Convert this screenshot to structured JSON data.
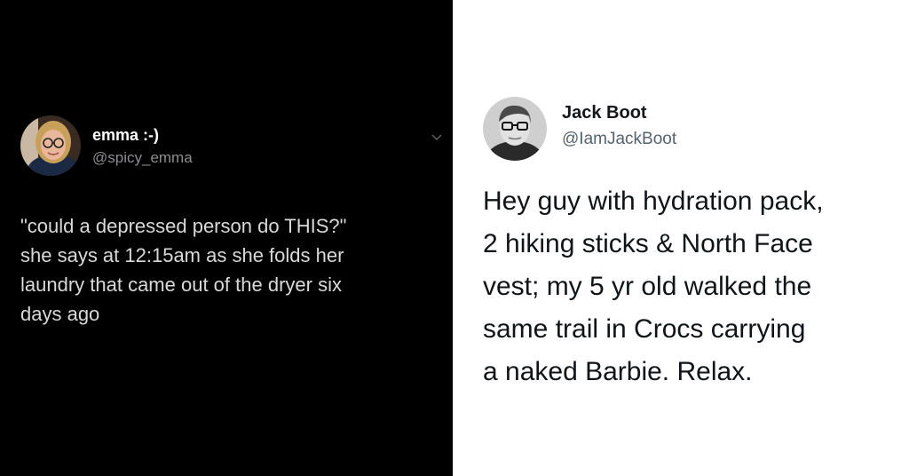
{
  "left_tweet": {
    "display_name": "emma :-)",
    "handle": "@spicy_emma",
    "text_lines": [
      "\"could a depressed person do THIS?\"",
      "she says at 12:15am as she folds her",
      "laundry that came out of the dryer six",
      "days ago"
    ],
    "avatar_icon": "avatar-photo-icon",
    "menu_icon": "chevron-down-icon"
  },
  "right_tweet": {
    "display_name": "Jack Boot",
    "handle": "@IamJackBoot",
    "text_lines": [
      "Hey guy with hydration pack,",
      "2 hiking sticks & North Face",
      "vest; my 5 yr old walked the",
      "same trail in Crocs carrying",
      "a naked Barbie. Relax."
    ],
    "avatar_icon": "avatar-photo-icon"
  },
  "colors": {
    "left_background": "#000000",
    "right_background": "#ffffff",
    "left_text": "#d8d9db",
    "left_handle": "#8b8d91",
    "right_text": "#0f1419",
    "right_handle": "#536471"
  }
}
